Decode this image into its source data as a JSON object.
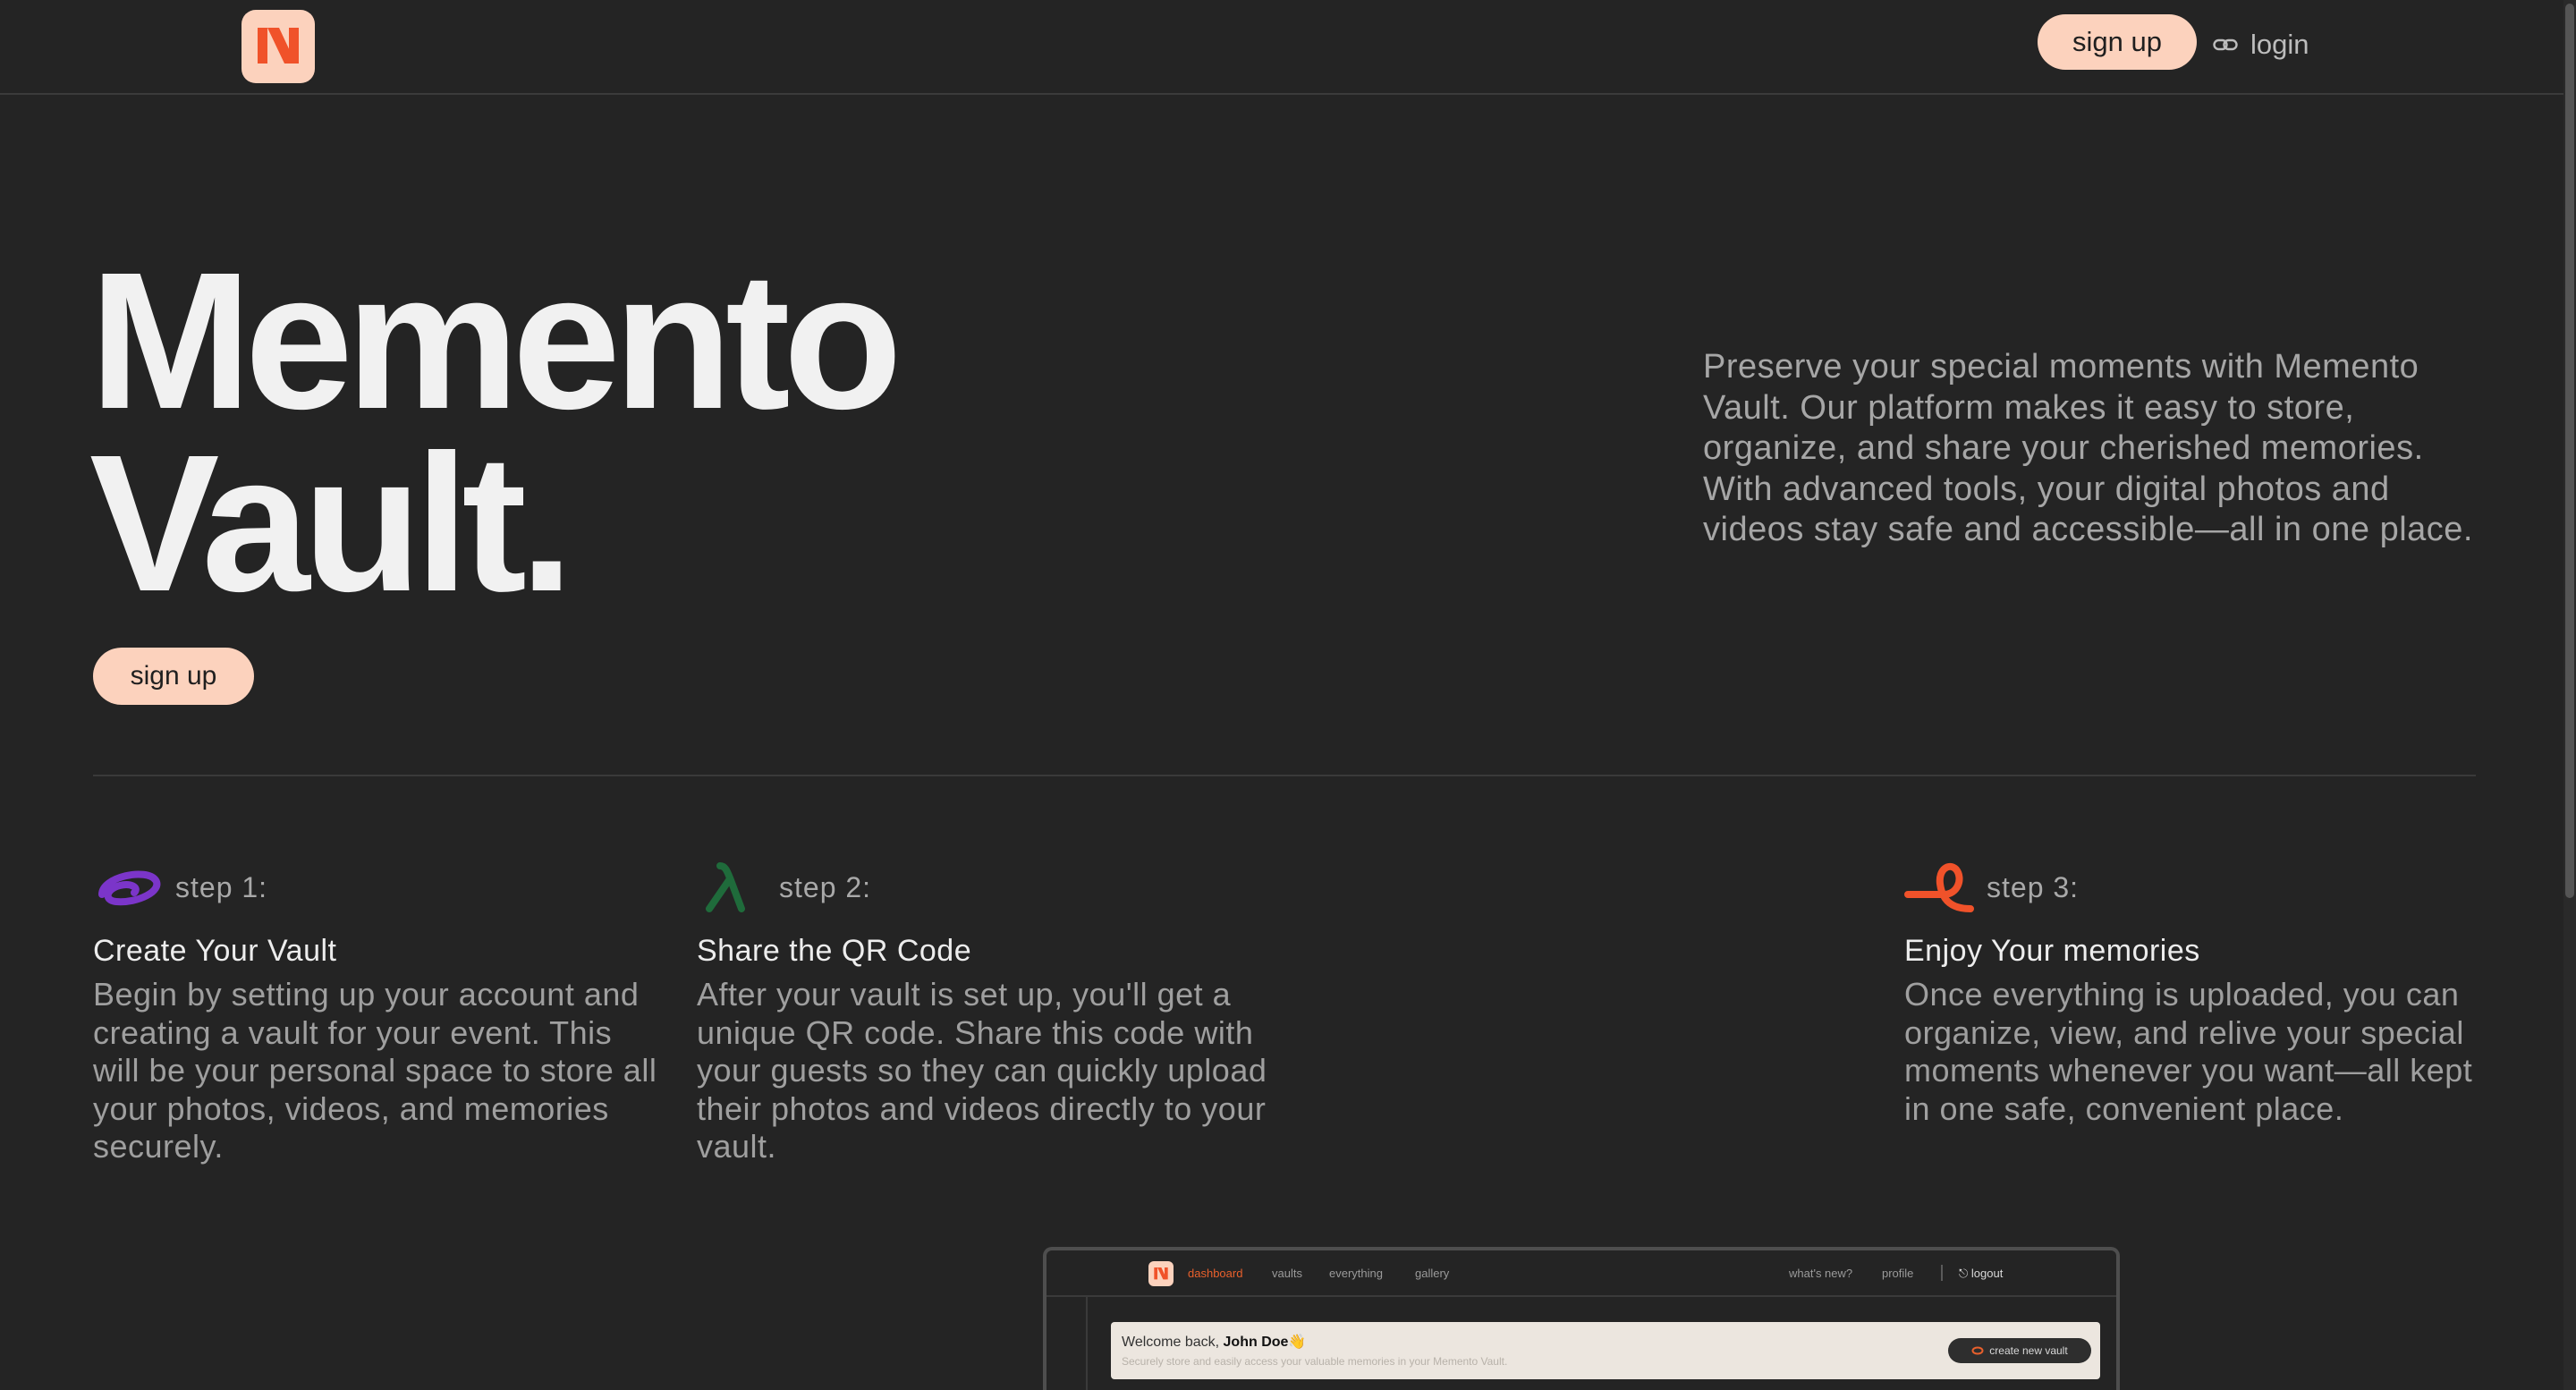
{
  "colors": {
    "background": "#242424",
    "accent_peach": "#fcd2bd",
    "accent_orange": "#e8602c",
    "step1_icon": "#7b35c9",
    "step2_icon": "#1f6b3b",
    "step3_icon": "#f0522a"
  },
  "header": {
    "logo_icon": "memento-logo-icon",
    "signup_label": "sign up",
    "login_label": "login",
    "login_icon": "link-icon"
  },
  "hero": {
    "title_line1": "Memento",
    "title_line2": "Vault.",
    "signup_label": "sign up",
    "description": "Preserve your special moments with Memento Vault. Our platform makes it easy to store, organize, and share your cherished memories. With advanced tools, your digital photos and videos stay safe and accessible—all in one place."
  },
  "steps": [
    {
      "label": "step 1:",
      "icon": "swirl-icon",
      "title": "Create Your Vault",
      "text": "Begin by setting up your account and creating a vault for your event. This will be your personal space to store all your photos, videos, and memories securely."
    },
    {
      "label": "step 2:",
      "icon": "lambda-icon",
      "title": "Share the QR Code",
      "text": "After your vault is set up, you'll get a unique QR code. Share this code with your guests so they can quickly upload their photos and videos directly to your vault."
    },
    {
      "label": "step 3:",
      "icon": "loop-ribbon-icon",
      "title": "Enjoy Your memories",
      "text": "Once everything is uploaded, you can organize, view, and relive your special moments whenever you want—all kept in one safe, convenient place."
    }
  ],
  "preview": {
    "nav": {
      "dashboard": "dashboard",
      "vaults": "vaults",
      "everything": "everything",
      "gallery": "gallery",
      "whats_new": "what's new?",
      "profile": "profile",
      "logout": "logout"
    },
    "welcome_prefix": "Welcome back,",
    "user_name": "John Doe",
    "welcome_emoji": "👋",
    "subtitle": "Securely store and easily access your valuable memories in your Memento Vault.",
    "create_button": "create new vault"
  }
}
